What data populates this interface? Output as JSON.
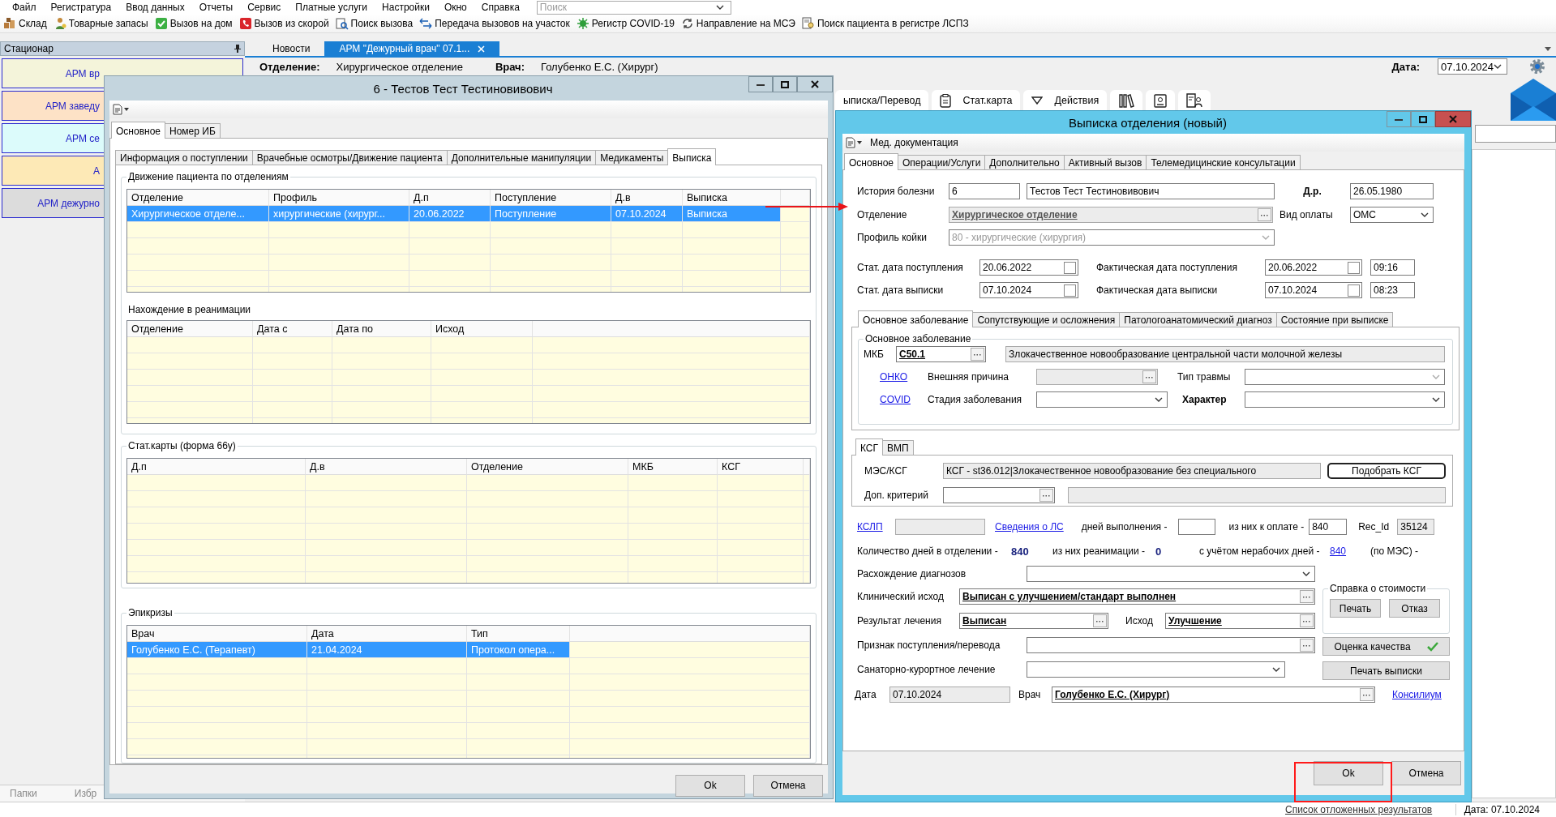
{
  "menu": [
    "Файл",
    "Регистратура",
    "Ввод данных",
    "Отчеты",
    "Сервис",
    "Платные услуги",
    "Настройки",
    "Окно",
    "Справка"
  ],
  "search": {
    "placeholder": "Поиск"
  },
  "toolbar": [
    "Склад",
    "Товарные запасы",
    "Вызов на дом",
    "Вызов из скорой",
    "Поиск вызова",
    "Передача вызовов на участок",
    "Регистр COVID-19",
    "Направление на МСЭ",
    "Поиск пациента в регистре ЛСПЗ"
  ],
  "sidebar": {
    "title": "Стационар",
    "items": [
      {
        "label": "АРМ вр",
        "color": "#f4f4da"
      },
      {
        "label": "АРМ заведу",
        "color": "#fde2c6"
      },
      {
        "label": "АРМ се",
        "color": "#dcfbfb"
      },
      {
        "label": "А",
        "color": "#fde9b6"
      },
      {
        "label": "АРМ дежурно",
        "color": "#dcdcdc"
      }
    ],
    "bottom_tabs": [
      "Папки",
      "Избр"
    ]
  },
  "doc_tabs": [
    {
      "label": "Новости",
      "selected": false
    },
    {
      "label": "АРМ \"Дежурный врач\" 07.1...",
      "selected": true
    }
  ],
  "header": {
    "department_label": "Отделение:",
    "department": "Хирургическое отделение",
    "doctor_label": "Врач:",
    "doctor": "Голубенко Е.С. (Хирург)",
    "date_label": "Дата:",
    "date": "07.10.2024"
  },
  "action_tabs": [
    "ыписка/Перевод",
    "Стат.карта",
    "Действия"
  ],
  "status_bar": {
    "link": "Список отложенных результатов",
    "date": "Дата: 07.10.2024"
  },
  "patient_window": {
    "title": "6 - Тестов Тест Тестиновивович",
    "tabs": [
      {
        "label": "Основное",
        "selected": true
      },
      {
        "label": "Номер ИБ",
        "selected": false
      }
    ],
    "subtabs": [
      {
        "label": "Информация о поступлении",
        "selected": false
      },
      {
        "label": "Врачебные осмотры/Движение пациента",
        "selected": false
      },
      {
        "label": "Дополнительные манипуляции",
        "selected": false
      },
      {
        "label": "Медикаменты",
        "selected": false
      },
      {
        "label": "Выписка",
        "selected": true
      }
    ],
    "movement": {
      "title": "Движение пациента по отделениям",
      "columns": [
        "Отделение",
        "Профиль",
        "Д.п",
        "Поступление",
        "Д.в",
        "Выписка"
      ],
      "rows": [
        {
          "cells": [
            "Хирургическое отделе...",
            "хирургические (хирург...",
            "20.06.2022",
            "Поступление",
            "07.10.2024",
            "Выписка"
          ],
          "selected": true
        }
      ]
    },
    "reanimation": {
      "title": "Нахождение в реанимации",
      "columns": [
        "Отделение",
        "Дата с",
        "Дата по",
        "Исход"
      ]
    },
    "stat_cards": {
      "title": "Стат.карты (форма 66у)",
      "columns": [
        "Д.п",
        "Д.в",
        "Отделение",
        "МКБ",
        "КСГ"
      ]
    },
    "epicrises": {
      "title": "Эпикризы",
      "columns": [
        "Врач",
        "Дата",
        "Тип"
      ],
      "rows": [
        {
          "cells": [
            "Голубенко Е.С. (Терапевт)",
            "21.04.2024",
            "Протокол опера..."
          ],
          "selected": true
        }
      ]
    },
    "buttons": [
      "Ok",
      "Отмена"
    ]
  },
  "discharge_window": {
    "title": "Выписка отделения (новый)",
    "menu": "Мед. документация",
    "tabs": [
      {
        "label": "Основное",
        "selected": true
      },
      {
        "label": "Операции/Услуги",
        "selected": false
      },
      {
        "label": "Дополнительно",
        "selected": false
      },
      {
        "label": "Активный вызов",
        "selected": false
      },
      {
        "label": "Телемедицинские консультации",
        "selected": false
      }
    ],
    "history": {
      "label": "История болезни",
      "number": "6",
      "name": "Тестов Тест Тестиновивович"
    },
    "birth": {
      "label": "Д.р.",
      "value": "26.05.1980"
    },
    "department": {
      "label": "Отделение",
      "value": "Хирургическое отделение"
    },
    "payment": {
      "label": "Вид оплаты",
      "value": "ОМС"
    },
    "bed_profile": {
      "label": "Профиль койки",
      "value": "80 - хирургические (хирургия)"
    },
    "dates": [
      {
        "stat_label": "Стат. дата поступления",
        "stat": "20.06.2022",
        "fact_label": "Фактическая дата поступления",
        "fact": "20.06.2022",
        "time": "09:16"
      },
      {
        "stat_label": "Стат. дата выписки",
        "stat": "07.10.2024",
        "fact_label": "Фактическая дата выписки",
        "fact": "07.10.2024",
        "time": "08:23"
      }
    ],
    "diagnosis_tabs": [
      {
        "label": "Основное заболевание",
        "selected": true
      },
      {
        "label": "Сопутствующие и осложнения",
        "selected": false
      },
      {
        "label": "Патологоанатомический диагноз",
        "selected": false
      },
      {
        "label": "Состояние при выписке",
        "selected": false
      }
    ],
    "diagnosis": {
      "title": "Основное заболевание",
      "mkb_label": "МКБ",
      "mkb": "C50.1",
      "mkb_text": "Злокачественное новообразование центральной части молочной железы",
      "onko_link": "ОНКО",
      "external_label": "Внешняя причина",
      "injury_label": "Тип травмы",
      "covid_link": "COVID",
      "stage_label": "Стадия заболевания",
      "character_label": "Характер"
    },
    "ksg_tabs": [
      {
        "label": "КСГ",
        "selected": true
      },
      {
        "label": "ВМП",
        "selected": false
      }
    ],
    "ksg": {
      "mes_label": "МЭС/КСГ",
      "mes": "КСГ - st36.012|Злокачественное новообразование без специального",
      "pick_button": "Подобрать КСГ",
      "extra_label": "Доп. критерий"
    },
    "kslp": {
      "link": "КСЛП",
      "ls_link": "Сведения о ЛС",
      "days_label": "дней выполнения -",
      "paid_label": "из них к оплате -",
      "paid": "840",
      "rec_label": "Rec_Id",
      "rec": "35124"
    },
    "days": {
      "label": "Количество дней в отделении -",
      "value": "840",
      "icu_label": "из них реанимации -",
      "icu": "0",
      "nonwork_label": "с учётом нерабочих дней -",
      "nonwork": "840",
      "mes_label": "(по МЭС) -"
    },
    "mismatch_label": "Расхождение диагнозов",
    "outcome": {
      "label": "Клинический исход",
      "value": "Выписан с улучшением/стандарт выполнен"
    },
    "result": {
      "label": "Результат лечения",
      "value": "Выписан",
      "outcome_label": "Исход",
      "outcome": "Улучшение"
    },
    "cost_group": {
      "title": "Справка о стоимости",
      "buttons": [
        "Печать",
        "Отказ"
      ]
    },
    "admission_label": "Признак поступления/перевода",
    "quality_button": "Оценка качества",
    "spa_label": "Санаторно-курортное лечение",
    "print_button": "Печать выписки",
    "signature": {
      "date_label": "Дата",
      "date": "07.10.2024",
      "doctor_label": "Врач",
      "doctor": "Голубенко Е.С. (Хирург)",
      "link": "Консилиум"
    },
    "buttons": [
      "Ok",
      "Отмена"
    ]
  }
}
